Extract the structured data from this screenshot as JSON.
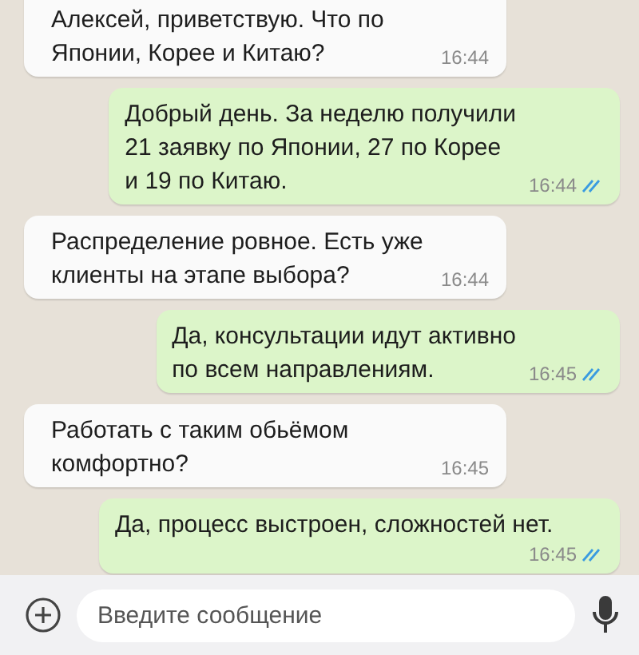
{
  "messages": [
    {
      "kind": "incoming",
      "text": "Алексей, приветствую. Что по\nЯпонии, Корее и Китаю?",
      "time": "16:44"
    },
    {
      "kind": "outgoing",
      "text": "Добрый день. За неделю получили\n21 заявку по Японии, 27 по Корее\nи 19 по Китаю.",
      "time": "16:44"
    },
    {
      "kind": "incoming",
      "text": "Распределение ровное. Есть уже\nклиенты на этапе выбора?",
      "time": "16:44"
    },
    {
      "kind": "outgoing",
      "text": "Да, консультации идут активно\nпо всем направлениям.",
      "time": "16:45"
    },
    {
      "kind": "incoming",
      "text": "Работать с таким обьёмом\nкомфортно?",
      "time": "16:45"
    },
    {
      "kind": "outgoing",
      "text": "Да, процесс выстроен, сложностей нет.",
      "time": "16:45"
    }
  ],
  "composer": {
    "placeholder": "Введите сообщение"
  }
}
